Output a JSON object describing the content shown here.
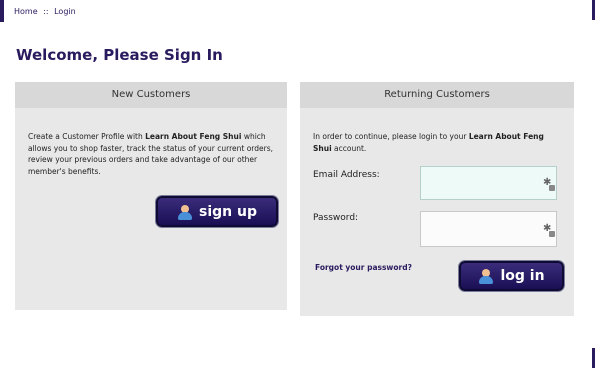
{
  "breadcrumb": {
    "home": "Home",
    "separator": "::",
    "current": "Login"
  },
  "page_title": "Welcome, Please Sign In",
  "new_customers": {
    "heading": "New Customers",
    "desc_part1": "Create a Customer Profile with ",
    "store_name": "Learn About Feng Shui",
    "desc_part2": " which allows you to shop faster, track the status of your current orders, review your previous orders and take advantage of our other member's benefits.",
    "signup_label": "sign up"
  },
  "returning_customers": {
    "heading": "Returning Customers",
    "desc_part1": "In order to continue, please login to your ",
    "store_name": "Learn About Feng Shui",
    "desc_part2": " account.",
    "email_label": "Email Address:",
    "email_value": "",
    "password_label": "Password:",
    "password_value": "",
    "forgot_label": "Forgot your password?",
    "login_label": "log in"
  },
  "colors": {
    "brand": "#2a1a5e",
    "panel": "#e8e8e8",
    "panel_header": "#d8d8d8",
    "active_input": "#eefaf8"
  },
  "icons": {
    "button_icon": "user-icon",
    "field_icon": "key-icon"
  }
}
